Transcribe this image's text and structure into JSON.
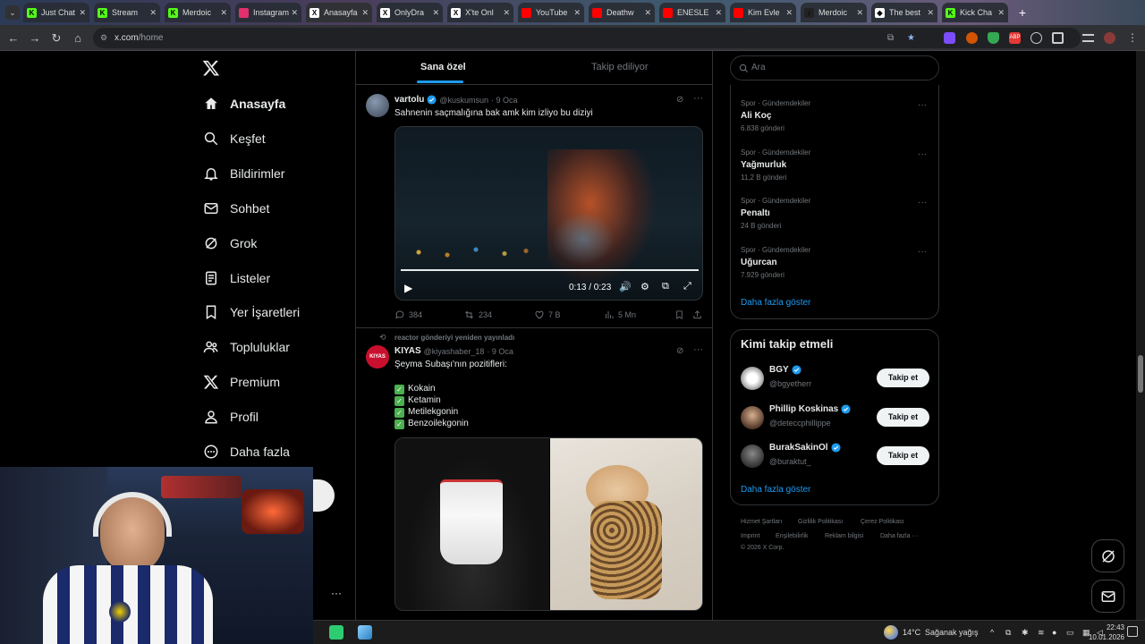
{
  "browser": {
    "tabs": [
      {
        "title": "Just Chat",
        "color": "#53fc18",
        "letter": "K"
      },
      {
        "title": "Stream",
        "color": "#53fc18",
        "letter": "K"
      },
      {
        "title": "Merdoic",
        "color": "#53fc18",
        "letter": "K"
      },
      {
        "title": "Instagram",
        "color": "#e1306c",
        "letter": ""
      },
      {
        "title": "Anasayfa",
        "color": "#ffffff",
        "letter": "X"
      },
      {
        "title": "OnlyDra",
        "color": "#ffffff",
        "letter": "X"
      },
      {
        "title": "X'te Onl",
        "color": "#ffffff",
        "letter": "X"
      },
      {
        "title": "YouTube",
        "color": "#ff0000",
        "letter": ""
      },
      {
        "title": "Deathw",
        "color": "#ff0000",
        "letter": ""
      },
      {
        "title": "ENESLE",
        "color": "#ff0000",
        "letter": ""
      },
      {
        "title": "Kim Evle",
        "color": "#ff0000",
        "letter": ""
      },
      {
        "title": "Merdoic",
        "color": "#222222",
        "letter": "♪"
      },
      {
        "title": "The best",
        "color": "#ffffff",
        "letter": "◆"
      },
      {
        "title": "Kick Cha",
        "color": "#53fc18",
        "letter": "K"
      }
    ],
    "url_host": "x.com",
    "url_path": "/home"
  },
  "nav": {
    "items": [
      {
        "label": "Anasayfa",
        "icon": "home-icon"
      },
      {
        "label": "Keşfet",
        "icon": "search-icon"
      },
      {
        "label": "Bildirimler",
        "icon": "bell-icon"
      },
      {
        "label": "Sohbet",
        "icon": "mail-icon"
      },
      {
        "label": "Grok",
        "icon": "grok-icon"
      },
      {
        "label": "Listeler",
        "icon": "list-icon"
      },
      {
        "label": "Yer İşaretleri",
        "icon": "bookmark-icon"
      },
      {
        "label": "Topluluklar",
        "icon": "people-icon"
      },
      {
        "label": "Premium",
        "icon": "x-icon"
      },
      {
        "label": "Profil",
        "icon": "person-icon"
      },
      {
        "label": "Daha fazla",
        "icon": "more-circle-icon"
      }
    ],
    "more_dots": "···"
  },
  "timeline": {
    "tabs": [
      "Sana özel",
      "Takip ediliyor"
    ],
    "tweet1": {
      "name": "vartolu",
      "handle": "@kuskumsun",
      "date": "· 9 Oca",
      "text": "Sahnenin saçmalığına bak amk kim izliyo bu diziyi",
      "video_time": "0:13 / 0:23",
      "replies": "384",
      "retweets": "234",
      "likes": "7 B",
      "views": "5 Mn",
      "video_progress": 1.0
    },
    "tweet2": {
      "repost_note": "reactor gönderiyi yeniden yayınladı",
      "name": "KIYAS",
      "avatar_text": "KIYAS",
      "handle": "@kiyashaber_18",
      "date": "· 9 Oca",
      "text": "Şeyma Subaşı'nın pozitifleri:",
      "items": [
        "Kokain",
        "Ketamin",
        "Metilekgonin",
        "Benzoilekgonin"
      ]
    }
  },
  "sidebar": {
    "search_placeholder": "Ara",
    "trends": [
      {
        "category": "Spor · Gündemdekiler",
        "name": "Ali Koç",
        "count": "6.838 gönderi"
      },
      {
        "category": "Spor · Gündemdekiler",
        "name": "Yağmurluk",
        "count": "11,2 B gönderi"
      },
      {
        "category": "Spor · Gündemdekiler",
        "name": "Penaltı",
        "count": "24 B gönderi"
      },
      {
        "category": "Spor · Gündemdekiler",
        "name": "Uğurcan",
        "count": "7.929 gönderi"
      }
    ],
    "show_more": "Daha fazla göster",
    "who_to_follow_title": "Kimi takip etmeli",
    "suggestions": [
      {
        "name": "BGY",
        "handle": "@bgyetherr"
      },
      {
        "name": "Phillip Koskinas",
        "handle": "@deteccphillippe"
      },
      {
        "name": "BurakSakinOl",
        "handle": "@buraktut_"
      }
    ],
    "follow_label": "Takip et",
    "show_more2": "Daha fazla göster",
    "footer": [
      "Hizmet Şartları",
      "Gizlilik Politikası",
      "Çerez Politikası",
      "Imprint",
      "Erişilebilirlik",
      "Reklam bilgisi",
      "Daha fazla ···",
      "© 2026 X Corp."
    ]
  },
  "taskbar": {
    "weather_temp": "14°C",
    "weather_text": "Sağanak yağış",
    "time": "22:43",
    "date": "10.01.2026"
  },
  "colors": {
    "accent": "#1d9bf0",
    "link": "#1d9bf0",
    "background": "#000000",
    "border": "#2f3336"
  }
}
